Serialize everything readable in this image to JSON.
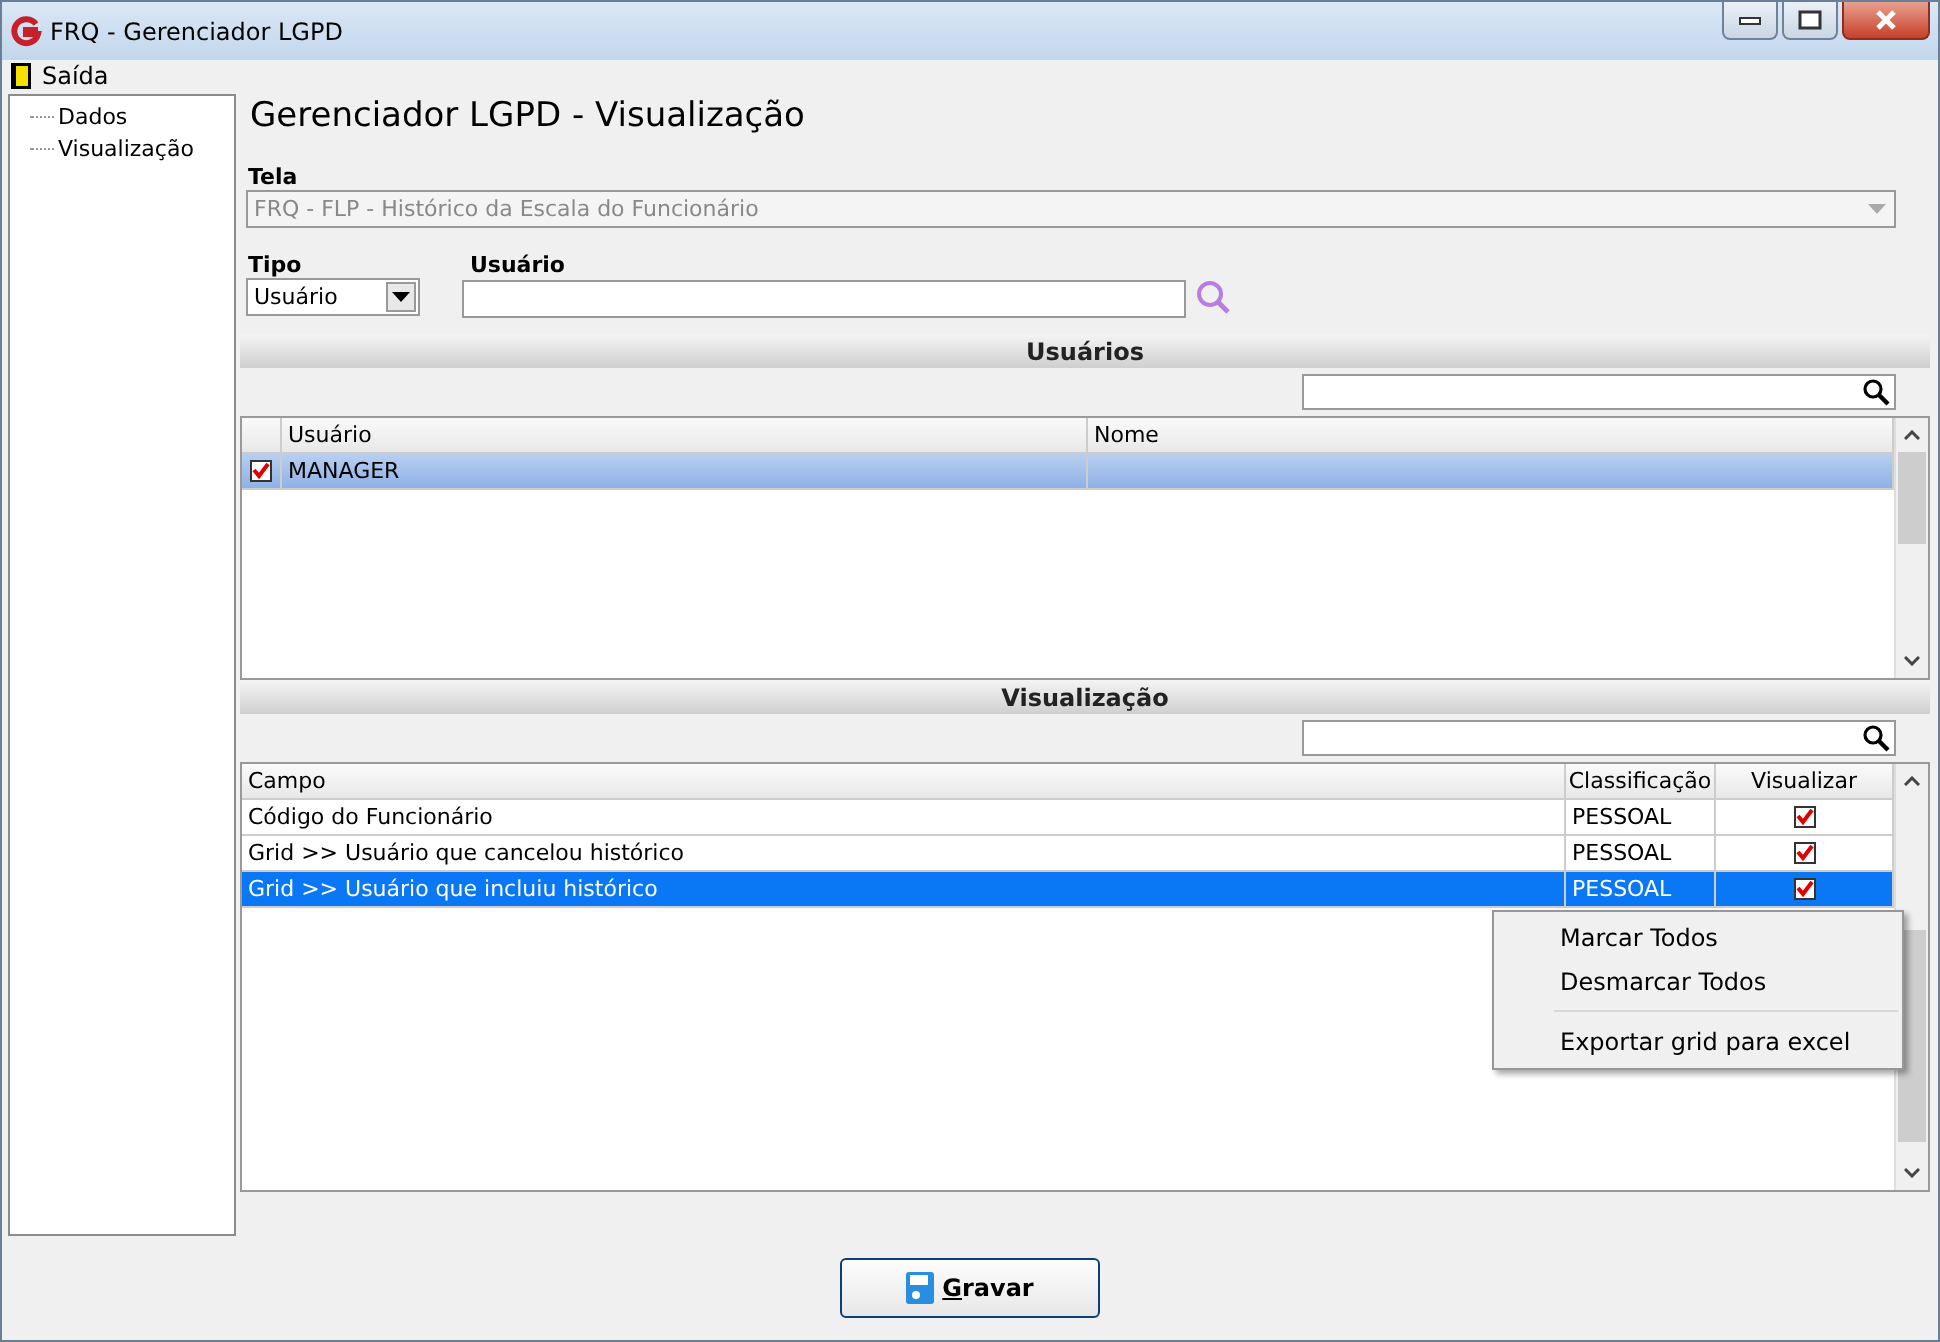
{
  "window": {
    "title": "FRQ - Gerenciador LGPD"
  },
  "menu_bar": {
    "items": [
      "Saída"
    ]
  },
  "sidebar": {
    "items": [
      "Dados",
      "Visualização"
    ]
  },
  "heading": "Gerenciador LGPD - Visualização",
  "tela": {
    "label": "Tela",
    "value": "FRQ - FLP - Histórico da Escala do Funcionário"
  },
  "tipo": {
    "label": "Tipo",
    "value": "Usuário"
  },
  "usuario": {
    "label": "Usuário"
  },
  "users_section": {
    "title": "Usuários",
    "columns": [
      "Usuário",
      "Nome"
    ],
    "rows": [
      {
        "usuario": "MANAGER",
        "checked": true,
        "selected": true
      }
    ]
  },
  "fields_section": {
    "title": "Visualização",
    "columns": [
      "Campo",
      "Classificação",
      "Visualizar"
    ],
    "rows": [
      {
        "campo": "Código do Funcionário",
        "classificacao": "PESSOAL",
        "visualizar": true,
        "selected": false
      },
      {
        "campo": "Grid >> Usuário que cancelou histórico",
        "classificacao": "PESSOAL",
        "visualizar": true,
        "selected": false
      },
      {
        "campo": "Grid >> Usuário que incluiu histórico",
        "classificacao": "PESSOAL",
        "visualizar": true,
        "selected": true
      }
    ]
  },
  "context_menu": {
    "items": [
      {
        "kind": "item",
        "label": "Marcar Todos"
      },
      {
        "kind": "item",
        "label": "Desmarcar Todos"
      },
      {
        "kind": "separator"
      },
      {
        "kind": "item",
        "label": "Exportar grid para excel"
      }
    ]
  },
  "save_button": {
    "label": "Gravar"
  }
}
